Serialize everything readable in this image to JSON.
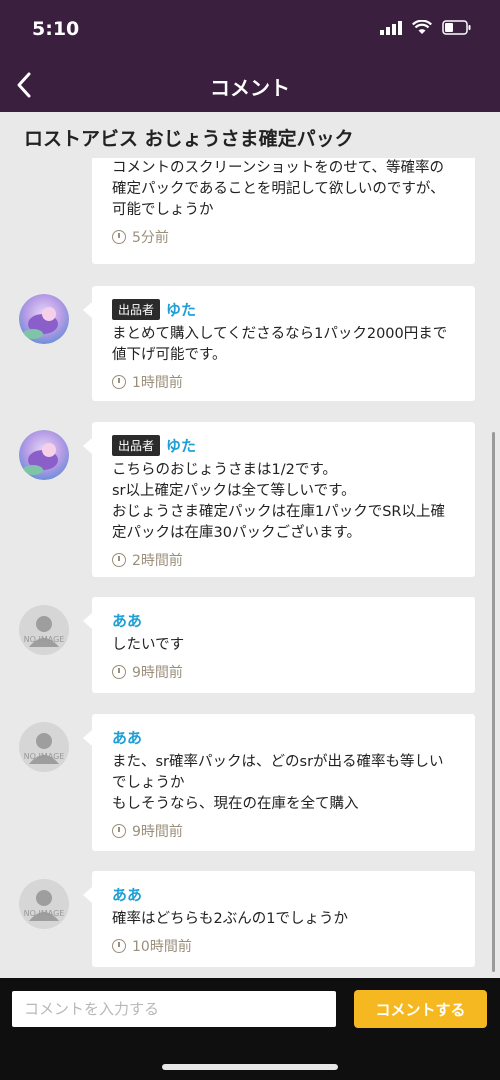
{
  "status_bar": {
    "time": "5:10"
  },
  "nav": {
    "title": "コメント"
  },
  "page_title": "ロストアビス おじょうさま確定パック",
  "colors": {
    "header_bg": "#3a1f3f",
    "accent": "#f5b820",
    "name": "#1e9fd6"
  },
  "comments": [
    {
      "text": "コメントのスクリーンショットをのせて、等確率の確定パックであることを明記して欲しいのですが、可能でしょうか",
      "time": "5分前"
    },
    {
      "badge": "出品者",
      "name": "ゆた",
      "text": "まとめて購入してくださるなら1パック2000円まで値下げ可能です。",
      "time": "1時間前"
    },
    {
      "badge": "出品者",
      "name": "ゆた",
      "text": "こちらのおじょうさまは1/2です。\nsr以上確定パックは全て等しいです。\nおじょうさま確定パックは在庫1パックでSR以上確定パックは在庫30パックございます。",
      "time": "2時間前"
    },
    {
      "name": "ああ",
      "avatar_label": "NO IMAGE",
      "text": "したいです",
      "time": "9時間前"
    },
    {
      "name": "ああ",
      "avatar_label": "NO IMAGE",
      "text": "また、sr確率パックは、どのsrが出る確率も等しいでしょうか\nもしそうなら、現在の在庫を全て購入",
      "time": "9時間前"
    },
    {
      "name": "ああ",
      "avatar_label": "NO IMAGE",
      "text": "確率はどちらも2ぶんの1でしょうか",
      "time": "10時間前"
    }
  ],
  "composer": {
    "placeholder": "コメントを入力する",
    "submit_label": "コメントする"
  }
}
